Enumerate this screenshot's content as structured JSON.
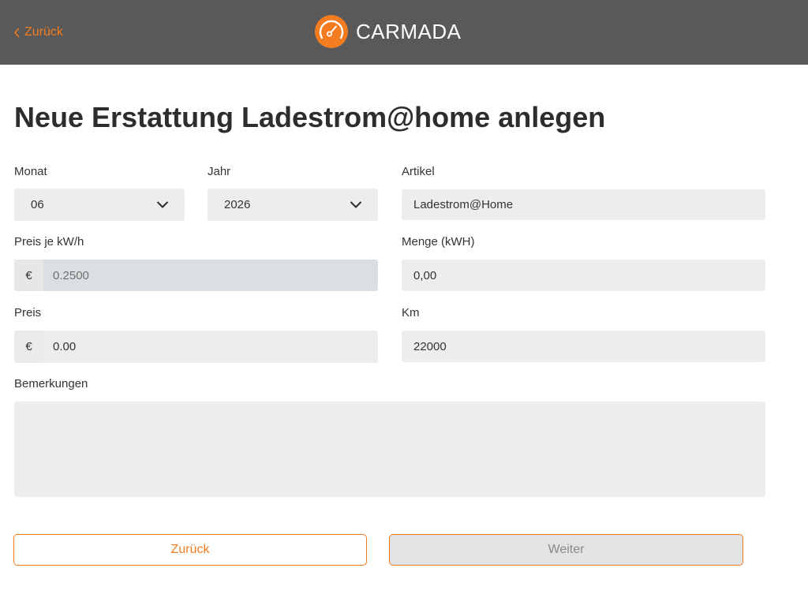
{
  "header": {
    "back_label": "Zurück",
    "brand_name": "CARMADA",
    "icons": {
      "back": "chevron-left-icon",
      "logo": "speedometer-logo-icon"
    },
    "colors": {
      "bar": "#595959",
      "accent": "#f47c20"
    }
  },
  "page": {
    "title": "Neue Erstattung Ladestrom@home anlegen"
  },
  "form": {
    "month": {
      "label": "Monat",
      "value": "06",
      "icon": "chevron-down-icon"
    },
    "year": {
      "label": "Jahr",
      "value": "2026",
      "icon": "chevron-down-icon"
    },
    "article": {
      "label": "Artikel",
      "value": "Ladestrom@Home"
    },
    "price_per_kwh": {
      "label": "Preis je kW/h",
      "currency": "€",
      "value": "0.2500"
    },
    "quantity": {
      "label": "Menge (kWH)",
      "value": "0,00"
    },
    "price": {
      "label": "Preis",
      "currency": "€",
      "value": "0.00"
    },
    "km": {
      "label": "Km",
      "value": "22000"
    },
    "remarks": {
      "label": "Bemerkungen",
      "value": ""
    }
  },
  "actions": {
    "back_label": "Zurück",
    "next_label": "Weiter"
  }
}
